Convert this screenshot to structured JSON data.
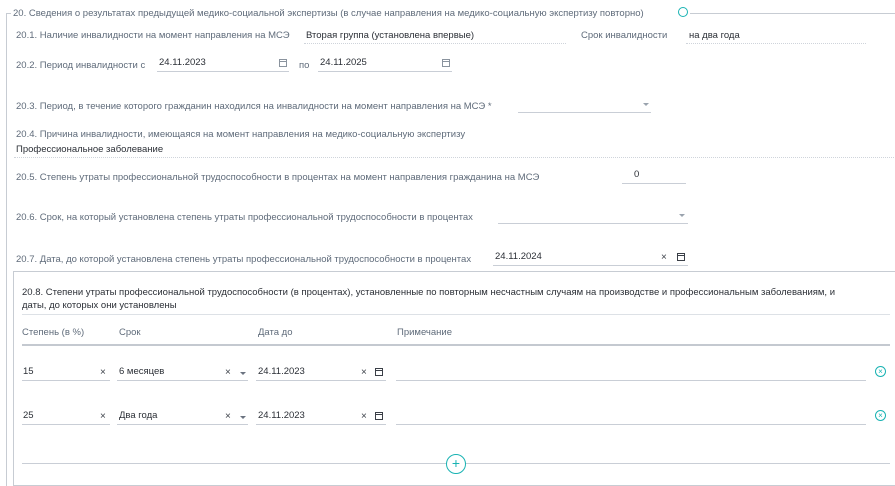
{
  "section": {
    "title": "20. Сведения о результатах предыдущей медико-социальной экспертизы (в случае направления на медико-социальную экспертизу повторно)"
  },
  "f20_1": {
    "label": "20.1. Наличие инвалидности на момент направления на МСЭ",
    "value": "Вторая группа (установлена впервые)",
    "term_label": "Срок инвалидности",
    "term_value": "на два года"
  },
  "f20_2": {
    "label": "20.2. Период инвалидности с",
    "from": "24.11.2023",
    "to_label": "по",
    "to": "24.11.2025"
  },
  "f20_3": {
    "label": "20.3. Период, в течение которого гражданин находился на инвалидности на момент направления на МСЭ *",
    "value": ""
  },
  "f20_4": {
    "label": "20.4. Причина инвалидности, имеющаяся на момент направления на медико-социальную экспертизу",
    "value": "Профессиональное заболевание"
  },
  "f20_5": {
    "label": "20.5. Степень утраты профессиональной трудоспособности в процентах на момент направления гражданина на МСЭ",
    "value": "0"
  },
  "f20_6": {
    "label": "20.6. Срок, на который установлена степень утраты профессиональной трудоспособности в процентах",
    "value": ""
  },
  "f20_7": {
    "label": "20.7. Дата, до которой установлена степень утраты профессиональной трудоспособности в процентах",
    "value": "24.11.2024"
  },
  "f20_8": {
    "title_line1": "20.8. Степени утраты профессиональной трудоспособности (в процентах), установленные по повторным несчастным случаям на производстве и профессиональным заболеваниям, и",
    "title_line2": "даты, до которых они установлены",
    "columns": [
      "Степень (в %)",
      "Срок",
      "Дата до",
      "Примечание"
    ],
    "rows": [
      {
        "degree": "15",
        "term": "6 месяцев",
        "date": "24.11.2023",
        "note": ""
      },
      {
        "degree": "25",
        "term": "Два года",
        "date": "24.11.2023",
        "note": ""
      }
    ]
  },
  "icons": {
    "clear": "×",
    "remove": "⊗",
    "add": "+",
    "collapse": "◌"
  },
  "colors": {
    "accent": "#19b3b3",
    "label": "#5f6b7a",
    "value": "#2b2f36",
    "line": "#c9ced6"
  }
}
